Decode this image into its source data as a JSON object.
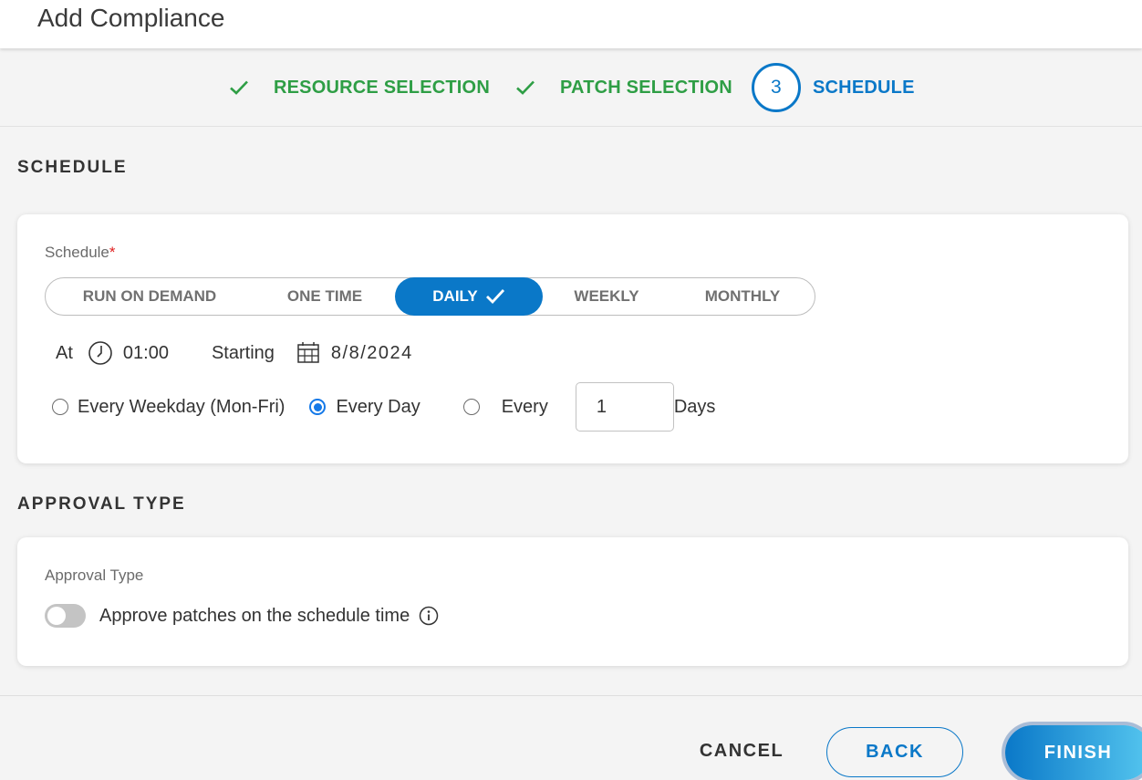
{
  "header": {
    "title": "Add Compliance"
  },
  "stepper": {
    "steps": [
      {
        "label": "RESOURCE SELECTION",
        "state": "done",
        "icon": "check-icon"
      },
      {
        "label": "PATCH SELECTION",
        "state": "done",
        "icon": "check-icon"
      },
      {
        "label": "SCHEDULE",
        "state": "active",
        "number": "3"
      }
    ]
  },
  "schedule_section": {
    "title": "SCHEDULE",
    "field_label": "Schedule",
    "required_mark": "*",
    "options": [
      {
        "label": "RUN ON DEMAND",
        "selected": false
      },
      {
        "label": "ONE TIME",
        "selected": false
      },
      {
        "label": "DAILY",
        "selected": true
      },
      {
        "label": "WEEKLY",
        "selected": false
      },
      {
        "label": "MONTHLY",
        "selected": false
      }
    ],
    "at_label": "At",
    "time_value": "01:00",
    "starting_label": "Starting",
    "date_value": "8/8/2024",
    "recurrence": {
      "options": [
        {
          "label": "Every Weekday (Mon-Fri)",
          "checked": false
        },
        {
          "label": "Every Day",
          "checked": true
        },
        {
          "label": "Every",
          "checked": false
        }
      ],
      "every_n_value": "1",
      "days_label": "Days"
    }
  },
  "approval_section": {
    "title": "APPROVAL TYPE",
    "field_label": "Approval Type",
    "toggle_label": "Approve patches on the schedule time",
    "toggle_on": false
  },
  "footer": {
    "cancel_label": "CANCEL",
    "back_label": "BACK",
    "finish_label": "FINISH"
  },
  "colors": {
    "primary": "#0a78c8",
    "success": "#2e9e45",
    "required": "#e02020"
  }
}
